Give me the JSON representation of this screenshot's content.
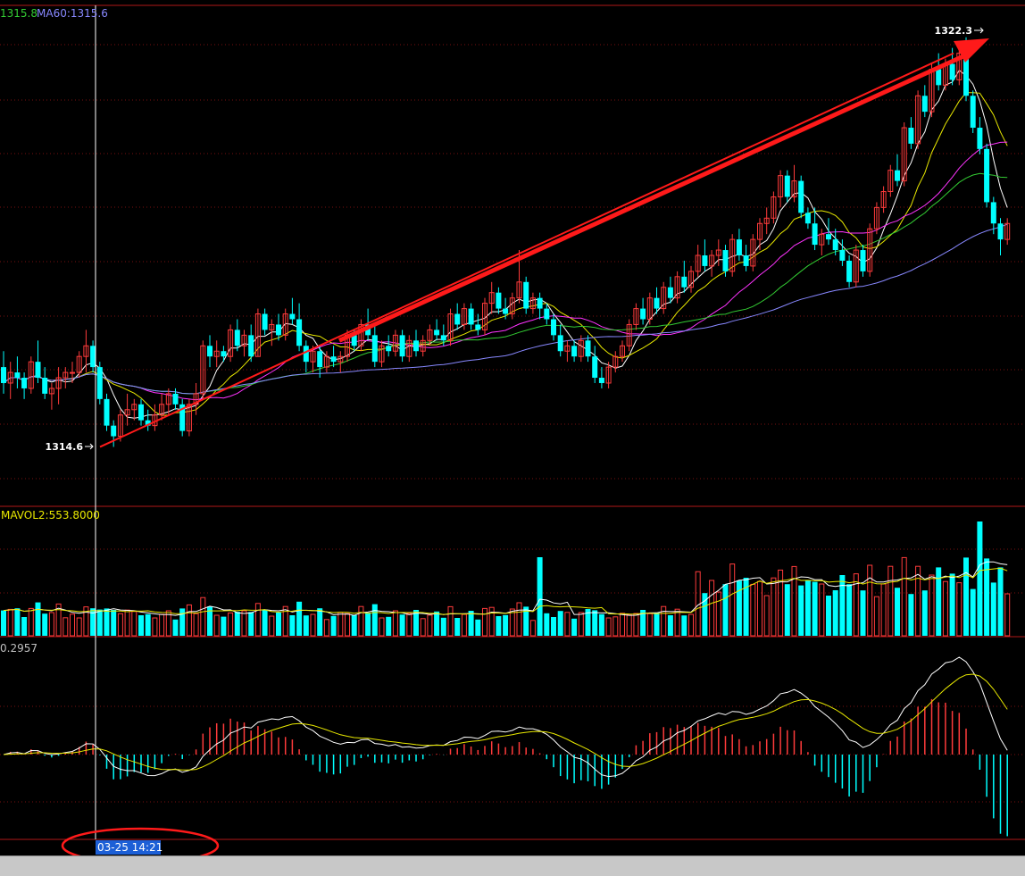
{
  "chart_data": [
    {
      "type": "candlestick",
      "panel": "price",
      "indicator_labels": [
        {
          "text": "1315.8",
          "color": "#33cc33"
        },
        {
          "text": "MA60:1315.6",
          "color": "#8888ff"
        }
      ],
      "annotations": {
        "high_label": "1322.3",
        "low_label": "1314.6",
        "trend_arrow": "from 1314.6 low to 1322.3 high"
      },
      "ylim": [
        1313.5,
        1322.9
      ],
      "ohlc": [
        [
          1316.1,
          1316.4,
          1315.6,
          1315.8
        ],
        [
          1315.8,
          1316.2,
          1315.5,
          1316.0
        ],
        [
          1316.0,
          1316.3,
          1315.7,
          1315.9
        ],
        [
          1315.9,
          1316.0,
          1315.5,
          1315.7
        ],
        [
          1315.7,
          1316.3,
          1315.6,
          1316.2
        ],
        [
          1316.2,
          1316.6,
          1315.8,
          1315.9
        ],
        [
          1315.9,
          1316.1,
          1315.5,
          1315.6
        ],
        [
          1315.6,
          1315.8,
          1315.3,
          1315.7
        ],
        [
          1315.7,
          1316.1,
          1315.4,
          1315.9
        ],
        [
          1315.9,
          1316.1,
          1315.7,
          1316.0
        ],
        [
          1316.0,
          1316.2,
          1315.8,
          1316.0
        ],
        [
          1316.0,
          1316.4,
          1315.9,
          1316.3
        ],
        [
          1316.3,
          1316.8,
          1316.0,
          1316.5
        ],
        [
          1316.5,
          1316.6,
          1316.0,
          1316.1
        ],
        [
          1316.1,
          1316.2,
          1315.4,
          1315.5
        ],
        [
          1315.5,
          1315.6,
          1314.9,
          1315.0
        ],
        [
          1315.0,
          1315.1,
          1314.6,
          1314.8
        ],
        [
          1314.8,
          1315.3,
          1314.7,
          1315.2
        ],
        [
          1315.2,
          1315.6,
          1315.0,
          1315.3
        ],
        [
          1315.3,
          1315.5,
          1315.1,
          1315.4
        ],
        [
          1315.4,
          1315.5,
          1315.0,
          1315.1
        ],
        [
          1315.1,
          1315.3,
          1314.9,
          1315.0
        ],
        [
          1315.0,
          1315.4,
          1314.9,
          1315.2
        ],
        [
          1315.2,
          1315.6,
          1315.1,
          1315.4
        ],
        [
          1315.4,
          1315.7,
          1315.2,
          1315.6
        ],
        [
          1315.6,
          1315.7,
          1315.3,
          1315.4
        ],
        [
          1315.4,
          1315.5,
          1314.8,
          1314.9
        ],
        [
          1314.9,
          1315.5,
          1314.8,
          1315.4
        ],
        [
          1315.4,
          1315.8,
          1315.2,
          1315.6
        ],
        [
          1315.6,
          1316.6,
          1315.5,
          1316.5
        ],
        [
          1316.5,
          1316.7,
          1316.1,
          1316.3
        ],
        [
          1316.3,
          1316.6,
          1316.1,
          1316.4
        ],
        [
          1316.4,
          1316.5,
          1316.2,
          1316.3
        ],
        [
          1316.3,
          1316.9,
          1316.2,
          1316.8
        ],
        [
          1316.8,
          1317.0,
          1316.4,
          1316.5
        ],
        [
          1316.5,
          1316.8,
          1316.3,
          1316.7
        ],
        [
          1316.7,
          1316.9,
          1316.2,
          1316.3
        ],
        [
          1316.3,
          1317.2,
          1316.3,
          1317.1
        ],
        [
          1317.1,
          1317.2,
          1316.7,
          1316.8
        ],
        [
          1316.8,
          1317.0,
          1316.5,
          1316.9
        ],
        [
          1316.9,
          1317.1,
          1316.6,
          1316.7
        ],
        [
          1316.7,
          1317.2,
          1316.6,
          1317.1
        ],
        [
          1317.1,
          1317.4,
          1316.9,
          1317.0
        ],
        [
          1317.0,
          1317.3,
          1316.4,
          1316.5
        ],
        [
          1316.5,
          1316.6,
          1316.0,
          1316.2
        ],
        [
          1316.2,
          1316.5,
          1316.0,
          1316.4
        ],
        [
          1316.4,
          1316.5,
          1315.9,
          1316.1
        ],
        [
          1316.1,
          1316.4,
          1316.0,
          1316.3
        ],
        [
          1316.3,
          1316.5,
          1316.1,
          1316.2
        ],
        [
          1316.2,
          1316.4,
          1316.0,
          1316.3
        ],
        [
          1316.3,
          1316.8,
          1316.2,
          1316.7
        ],
        [
          1316.7,
          1316.8,
          1316.4,
          1316.5
        ],
        [
          1316.5,
          1317.0,
          1316.4,
          1316.9
        ],
        [
          1316.9,
          1317.2,
          1316.6,
          1316.7
        ],
        [
          1316.7,
          1316.9,
          1316.1,
          1316.2
        ],
        [
          1316.2,
          1316.6,
          1316.1,
          1316.5
        ],
        [
          1316.5,
          1316.7,
          1316.3,
          1316.4
        ],
        [
          1316.4,
          1316.8,
          1316.3,
          1316.7
        ],
        [
          1316.7,
          1316.8,
          1316.2,
          1316.3
        ],
        [
          1316.3,
          1316.7,
          1316.2,
          1316.6
        ],
        [
          1316.6,
          1316.8,
          1316.3,
          1316.4
        ],
        [
          1316.4,
          1316.7,
          1316.3,
          1316.6
        ],
        [
          1316.6,
          1316.9,
          1316.5,
          1316.8
        ],
        [
          1316.8,
          1317.0,
          1316.6,
          1316.7
        ],
        [
          1316.7,
          1316.9,
          1316.5,
          1316.6
        ],
        [
          1316.6,
          1317.2,
          1316.5,
          1317.1
        ],
        [
          1317.1,
          1317.3,
          1316.8,
          1316.9
        ],
        [
          1316.9,
          1317.3,
          1316.8,
          1317.2
        ],
        [
          1317.2,
          1317.3,
          1316.8,
          1316.9
        ],
        [
          1316.9,
          1317.1,
          1316.7,
          1316.8
        ],
        [
          1316.8,
          1317.4,
          1316.7,
          1317.3
        ],
        [
          1317.3,
          1317.7,
          1317.1,
          1317.5
        ],
        [
          1317.5,
          1317.6,
          1317.1,
          1317.2
        ],
        [
          1317.2,
          1317.4,
          1317.0,
          1317.1
        ],
        [
          1317.1,
          1317.5,
          1317.0,
          1317.4
        ],
        [
          1317.4,
          1318.3,
          1317.3,
          1317.7
        ],
        [
          1317.7,
          1317.8,
          1317.1,
          1317.2
        ],
        [
          1317.2,
          1317.5,
          1317.1,
          1317.4
        ],
        [
          1317.4,
          1317.5,
          1317.0,
          1317.2
        ],
        [
          1317.2,
          1317.3,
          1316.9,
          1317.0
        ],
        [
          1317.0,
          1317.1,
          1316.6,
          1316.7
        ],
        [
          1316.7,
          1316.9,
          1316.3,
          1316.4
        ],
        [
          1316.4,
          1316.6,
          1316.2,
          1316.5
        ],
        [
          1316.5,
          1316.6,
          1316.2,
          1316.3
        ],
        [
          1316.3,
          1316.7,
          1316.2,
          1316.6
        ],
        [
          1316.6,
          1316.7,
          1316.2,
          1316.3
        ],
        [
          1316.3,
          1316.5,
          1315.8,
          1315.9
        ],
        [
          1315.9,
          1316.1,
          1315.7,
          1315.8
        ],
        [
          1315.8,
          1316.2,
          1315.7,
          1316.1
        ],
        [
          1316.1,
          1316.4,
          1316.0,
          1316.3
        ],
        [
          1316.3,
          1316.6,
          1316.2,
          1316.5
        ],
        [
          1316.5,
          1317.0,
          1316.4,
          1316.9
        ],
        [
          1316.9,
          1317.3,
          1316.8,
          1317.2
        ],
        [
          1317.2,
          1317.4,
          1316.9,
          1317.0
        ],
        [
          1317.0,
          1317.5,
          1316.9,
          1317.4
        ],
        [
          1317.4,
          1317.6,
          1317.1,
          1317.2
        ],
        [
          1317.2,
          1317.7,
          1317.1,
          1317.6
        ],
        [
          1317.6,
          1317.8,
          1317.3,
          1317.4
        ],
        [
          1317.4,
          1317.9,
          1317.3,
          1317.8
        ],
        [
          1317.8,
          1318.1,
          1317.5,
          1317.6
        ],
        [
          1317.6,
          1318.0,
          1317.5,
          1317.9
        ],
        [
          1317.9,
          1318.4,
          1317.8,
          1318.2
        ],
        [
          1318.2,
          1318.5,
          1317.9,
          1318.0
        ],
        [
          1318.0,
          1318.3,
          1317.8,
          1318.2
        ],
        [
          1318.2,
          1318.5,
          1318.0,
          1318.3
        ],
        [
          1318.3,
          1318.4,
          1317.8,
          1317.9
        ],
        [
          1317.9,
          1318.6,
          1317.8,
          1318.5
        ],
        [
          1318.5,
          1318.7,
          1318.1,
          1318.2
        ],
        [
          1318.2,
          1318.4,
          1317.9,
          1318.0
        ],
        [
          1318.0,
          1318.6,
          1317.9,
          1318.5
        ],
        [
          1318.5,
          1318.9,
          1318.3,
          1318.8
        ],
        [
          1318.8,
          1319.1,
          1318.6,
          1318.9
        ],
        [
          1318.9,
          1319.4,
          1318.8,
          1319.3
        ],
        [
          1319.3,
          1319.8,
          1319.1,
          1319.7
        ],
        [
          1319.7,
          1319.8,
          1319.2,
          1319.3
        ],
        [
          1319.3,
          1319.9,
          1319.2,
          1319.6
        ],
        [
          1319.6,
          1319.7,
          1318.9,
          1319.0
        ],
        [
          1319.0,
          1319.1,
          1318.7,
          1318.8
        ],
        [
          1318.8,
          1319.1,
          1318.3,
          1318.4
        ],
        [
          1318.4,
          1318.7,
          1318.2,
          1318.6
        ],
        [
          1318.6,
          1318.9,
          1318.4,
          1318.5
        ],
        [
          1318.5,
          1318.7,
          1318.2,
          1318.3
        ],
        [
          1318.3,
          1318.5,
          1318.0,
          1318.1
        ],
        [
          1318.1,
          1318.2,
          1317.6,
          1317.7
        ],
        [
          1317.7,
          1318.4,
          1317.6,
          1318.3
        ],
        [
          1318.3,
          1318.4,
          1317.8,
          1317.9
        ],
        [
          1317.9,
          1318.8,
          1317.8,
          1318.7
        ],
        [
          1318.7,
          1319.2,
          1318.6,
          1319.1
        ],
        [
          1319.1,
          1319.5,
          1319.0,
          1319.4
        ],
        [
          1319.4,
          1319.9,
          1319.3,
          1319.8
        ],
        [
          1319.8,
          1320.1,
          1319.5,
          1319.6
        ],
        [
          1319.6,
          1320.7,
          1319.5,
          1320.6
        ],
        [
          1320.6,
          1320.8,
          1320.2,
          1320.3
        ],
        [
          1320.3,
          1321.3,
          1320.2,
          1321.2
        ],
        [
          1321.2,
          1321.4,
          1320.8,
          1320.9
        ],
        [
          1320.9,
          1321.8,
          1320.8,
          1321.7
        ],
        [
          1321.7,
          1322.0,
          1321.3,
          1321.4
        ],
        [
          1321.4,
          1321.9,
          1321.3,
          1321.8
        ],
        [
          1321.8,
          1322.1,
          1321.4,
          1321.5
        ],
        [
          1321.5,
          1322.2,
          1321.4,
          1322.0
        ],
        [
          1322.0,
          1322.3,
          1321.1,
          1321.2
        ],
        [
          1321.2,
          1321.3,
          1320.5,
          1320.6
        ],
        [
          1320.6,
          1320.8,
          1320.1,
          1320.2
        ],
        [
          1320.2,
          1320.3,
          1319.1,
          1319.2
        ],
        [
          1319.2,
          1319.3,
          1318.6,
          1318.8
        ],
        [
          1318.8,
          1318.9,
          1318.2,
          1318.5
        ],
        [
          1318.5,
          1318.9,
          1318.4,
          1318.8
        ]
      ],
      "volume_panel": {
        "label": "MAVOL2:553.8000",
        "label_color": "#e8e800"
      },
      "macd_panel": {
        "label": "0.2957",
        "label_color": "#c0c0c0"
      },
      "cursor": {
        "time_label": "03-25 14:21"
      },
      "colors": {
        "up": "#ff3b3b",
        "down": "#00ffff",
        "background": "#000000",
        "grid": "#7a1010",
        "trend_arrow": "#ff1a1a",
        "highlight": "#1c5fd6"
      },
      "grid": true
    }
  ]
}
